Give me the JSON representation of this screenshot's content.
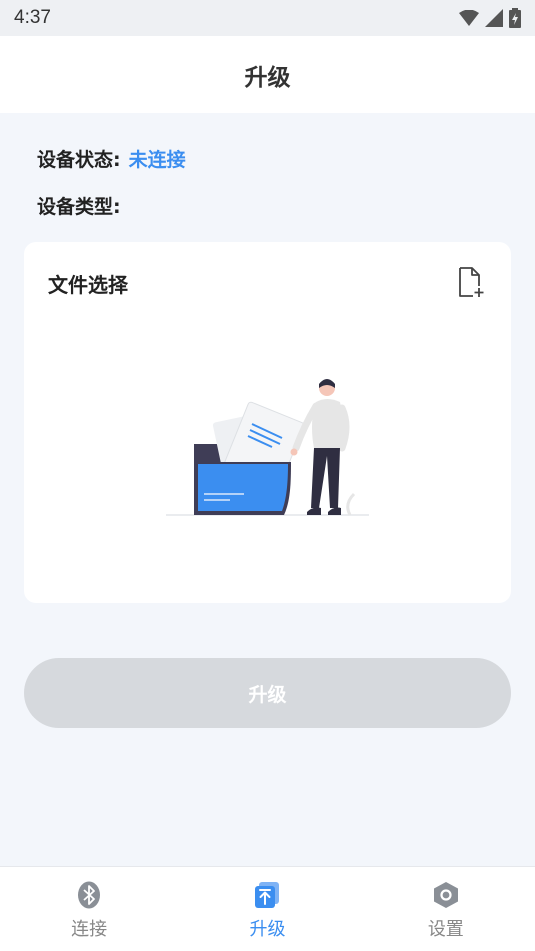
{
  "status_bar": {
    "time": "4:37"
  },
  "app_bar": {
    "title": "升级"
  },
  "device": {
    "status_label": "设备状态:",
    "status_value": "未连接",
    "type_label": "设备类型:",
    "type_value": ""
  },
  "file_card": {
    "title": "文件选择",
    "add_icon": "file-add-icon"
  },
  "upgrade_button": {
    "label": "升级"
  },
  "tabs": [
    {
      "label": "连接",
      "icon": "bluetooth-icon",
      "active": false
    },
    {
      "label": "升级",
      "icon": "upgrade-icon",
      "active": true
    },
    {
      "label": "设置",
      "icon": "settings-icon",
      "active": false
    }
  ],
  "colors": {
    "accent": "#3b8ef0",
    "button_disabled": "#d6d9dd",
    "background": "#f3f6fb"
  }
}
